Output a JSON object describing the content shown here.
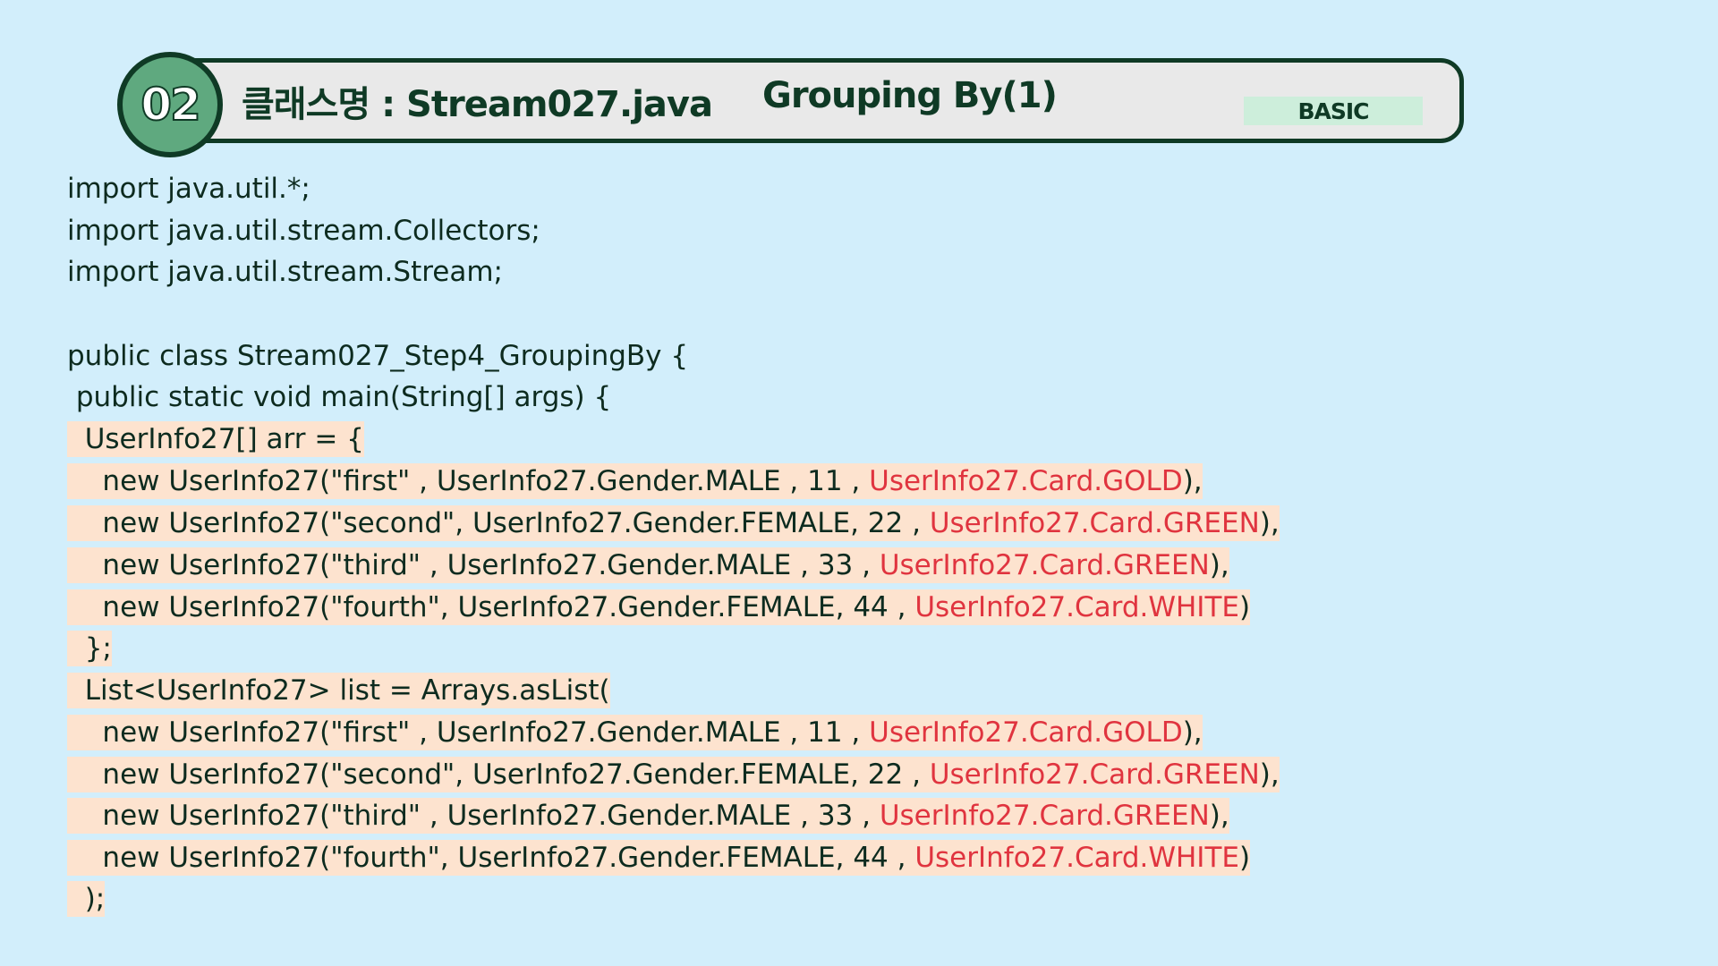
{
  "header": {
    "number": "02",
    "class_title": "클래스명 : Stream027.java",
    "section_title": "Grouping By(1)",
    "level": "BASIC"
  },
  "code": {
    "lines": [
      {
        "text": "import java.util.*;",
        "red": ""
      },
      {
        "text": "import java.util.stream.Collectors;",
        "red": ""
      },
      {
        "text": "import java.util.stream.Stream;",
        "red": ""
      },
      {
        "text": "public class Stream027_Step4_GroupingBy {",
        "red": ""
      },
      {
        "text": " public static void main(String[] args) {",
        "red": ""
      },
      {
        "text": "  UserInfo27[] arr = {",
        "red": ""
      },
      {
        "text": "    new UserInfo27(\"first\" , UserInfo27.Gender.MALE , 11 , ",
        "red": "UserInfo27.Card.GOLD",
        "tail": "),"
      },
      {
        "text": "    new UserInfo27(\"second\", UserInfo27.Gender.FEMALE, 22 , ",
        "red": "UserInfo27.Card.GREEN",
        "tail": "),"
      },
      {
        "text": "    new UserInfo27(\"third\" , UserInfo27.Gender.MALE , 33 , ",
        "red": "UserInfo27.Card.GREEN",
        "tail": "),"
      },
      {
        "text": "    new UserInfo27(\"fourth\", UserInfo27.Gender.FEMALE, 44 , ",
        "red": "UserInfo27.Card.WHITE",
        "tail": ")"
      },
      {
        "text": "  };",
        "red": ""
      },
      {
        "text": "  List<UserInfo27> list = Arrays.asList(",
        "red": ""
      },
      {
        "text": "    new UserInfo27(\"first\" , UserInfo27.Gender.MALE , 11 , ",
        "red": "UserInfo27.Card.GOLD",
        "tail": "),"
      },
      {
        "text": "    new UserInfo27(\"second\", UserInfo27.Gender.FEMALE, 22 , ",
        "red": "UserInfo27.Card.GREEN",
        "tail": "),"
      },
      {
        "text": "    new UserInfo27(\"third\" , UserInfo27.Gender.MALE , 33 , ",
        "red": "UserInfo27.Card.GREEN",
        "tail": "),"
      },
      {
        "text": "    new UserInfo27(\"fourth\", UserInfo27.Gender.FEMALE, 44 , ",
        "red": "UserInfo27.Card.WHITE",
        "tail": ")"
      },
      {
        "text": "  );",
        "red": ""
      }
    ]
  }
}
